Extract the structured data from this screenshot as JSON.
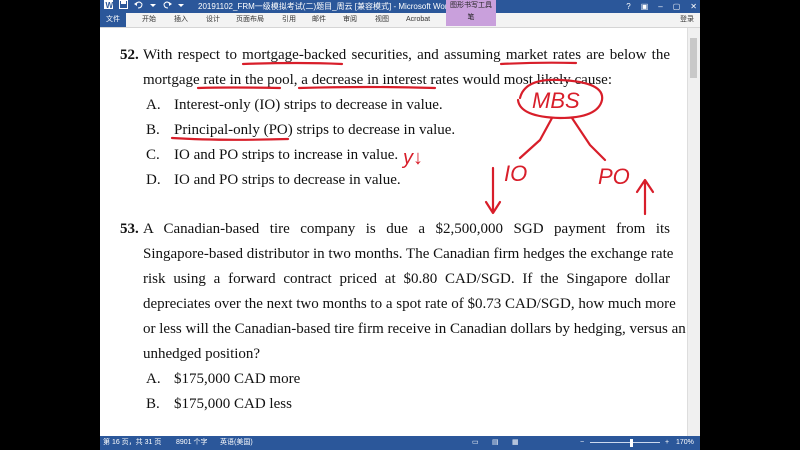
{
  "window": {
    "title": "20191102_FRM一级模拟考试(二)题目_周云 [兼容模式] - Microsoft Word",
    "context_tab": "图形书写工具",
    "context_sub": "笔"
  },
  "ribbon": {
    "file": "文件",
    "tabs": [
      "开始",
      "插入",
      "设计",
      "页面布局",
      "引用",
      "邮件",
      "审阅",
      "视图",
      "Acrobat"
    ],
    "login": "登录"
  },
  "q52": {
    "number": "52.",
    "line1": "With respect to mortgage-backed securities, and assuming market rates are below the",
    "line2": "mortgage rate in the pool, a decrease in interest rates would most likely cause:",
    "options": [
      {
        "letter": "A.",
        "text": "Interest-only (IO) strips to decrease in value."
      },
      {
        "letter": "B.",
        "text": "Principal-only (PO) strips to decrease in value."
      },
      {
        "letter": "C.",
        "text": "IO and PO strips to increase in value."
      },
      {
        "letter": "D.",
        "text": "IO and PO strips to decrease in value."
      }
    ]
  },
  "q53": {
    "number": "53.",
    "lines": [
      "A Canadian-based tire company is due a $2,500,000 SGD payment from its",
      "Singapore-based distributor in two months. The Canadian firm hedges the exchange rate",
      "risk using a forward contract priced at $0.80 CAD/SGD. If the Singapore dollar",
      "depreciates over the next two months to a spot rate of $0.73 CAD/SGD, how much more",
      "or less will the Canadian-based tire firm receive in Canadian dollars by hedging, versus an",
      "unhedged position?"
    ],
    "options": [
      {
        "letter": "A.",
        "text": "$175,000 CAD more"
      },
      {
        "letter": "B.",
        "text": "$175,000 CAD less"
      }
    ]
  },
  "annotations": {
    "mbs": "MBS",
    "io": "IO",
    "po": "PO",
    "yield_down": "y↓",
    "ink_color": "#d81e2a"
  },
  "status": {
    "page": "第 16 页，共 31 页",
    "words": "8901 个字",
    "language": "英语(美国)",
    "zoom": "170%",
    "zoom_minus": "−",
    "zoom_plus": "+"
  }
}
